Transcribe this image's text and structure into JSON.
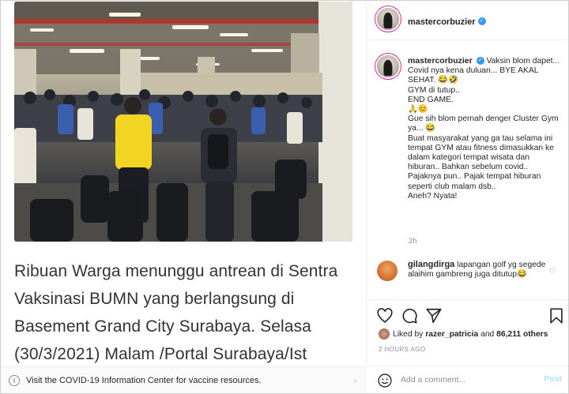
{
  "covid_banner": {
    "text": "Visit the COVID-19 Information Center for vaccine resources.",
    "icon": "info-icon"
  },
  "media": {
    "caption": "Ribuan Warga menunggu antrean di Sentra Vaksinasi BUMN yang berlangsung di Basement Grand City Surabaya. Selasa (30/3/2021) Malam /Portal Surabaya/Ist"
  },
  "post": {
    "author": "mastercorbuzier",
    "caption_lines": [
      "Vaksin blom dapet... Covid nya kena duluan... BYE AKAL SEHAT. 😂🤣",
      "GYM di tutup..",
      "END GAME.",
      "🙏😊",
      "Gue sih blom pernah denger Cluster Gym ya... 😂",
      "Buat masyarakat yang ga tau selama ini tempat GYM atau fitness dimasukkan ke dalam kategori tempat wisata dan hiburan.. Bahkan sebelum covid.. Pajaknya pun.. Pajak tempat hiburan seperti club malam dsb..",
      "Aneh? Nyata!"
    ],
    "caption_time": "2h",
    "comments": [
      {
        "user": "gilangdirga",
        "text": "lapangan golf yg segede alaihim gambreng juga ditutup😂"
      }
    ],
    "likes_text": "Liked by",
    "likes_user": "razer_patricia",
    "likes_and": "and",
    "likes_count": "86,211 others",
    "time_ago": "2 HOURS AGO",
    "add_comment_placeholder": "Add a comment...",
    "post_label": "Post"
  },
  "icons": {
    "verified": "✓",
    "more": "•••"
  }
}
